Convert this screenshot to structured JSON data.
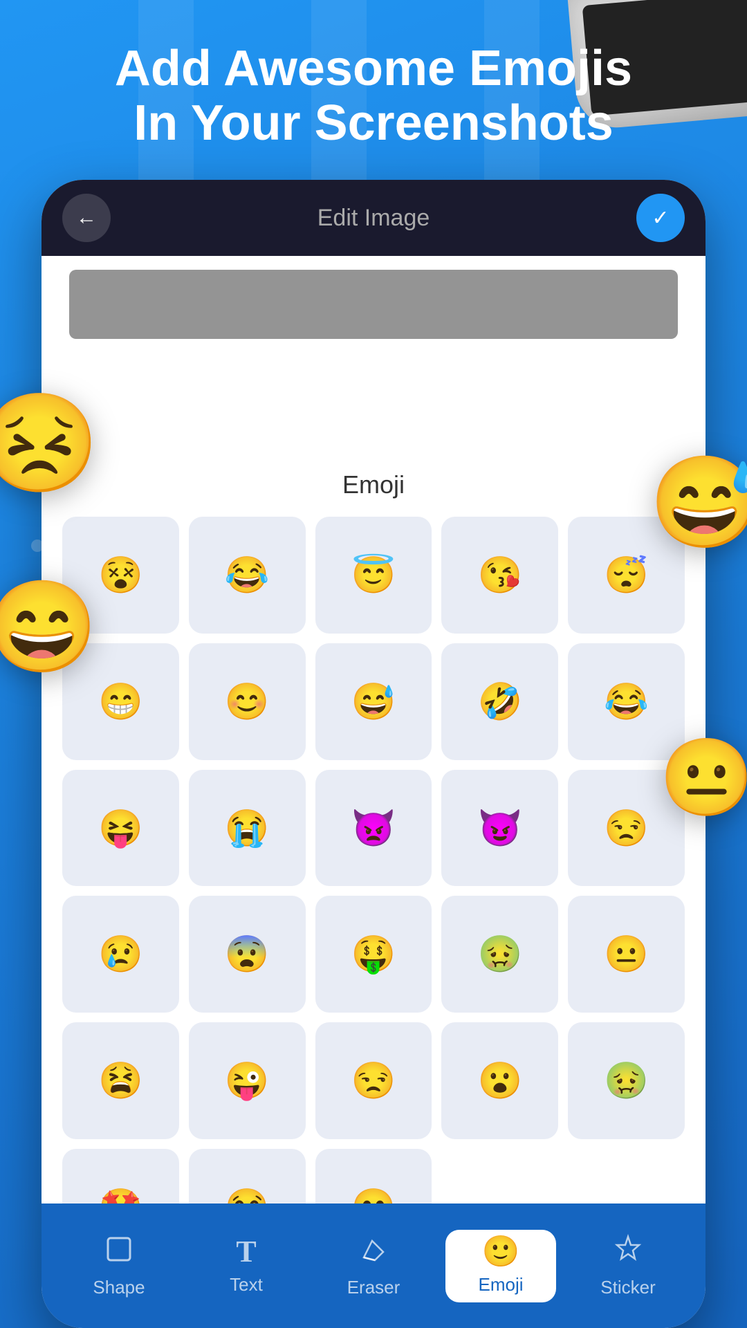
{
  "header": {
    "line1": "Add Awesome Emojis",
    "line2": "In Your Screenshots"
  },
  "topbar": {
    "title": "Edit Image",
    "back_icon": "←",
    "check_icon": "✓"
  },
  "emoji_panel": {
    "title": "Emoji"
  },
  "emojis": [
    "😵",
    "😂",
    "😇",
    "😘",
    "😴",
    "😁",
    "😊",
    "😅",
    "🤣",
    "😂",
    "😝",
    "😭",
    "👿",
    "😈",
    "😒",
    "😢",
    "😨",
    "🤑",
    "🤮",
    "😐",
    "😫",
    "😜",
    "😒",
    "😮",
    "🤢",
    "🤩",
    "😂",
    "😄"
  ],
  "floating_emojis": {
    "left1": "😣",
    "left2": "😄",
    "right1": "😅",
    "right2": "😐"
  },
  "bottom_nav": {
    "items": [
      {
        "id": "shape",
        "label": "Shape",
        "icon": "⬜",
        "active": false
      },
      {
        "id": "text",
        "label": "Text",
        "icon": "T",
        "active": false
      },
      {
        "id": "eraser",
        "label": "Eraser",
        "icon": "⌫",
        "active": false
      },
      {
        "id": "emoji",
        "label": "Emoji",
        "icon": "🙂",
        "active": true
      },
      {
        "id": "sticker",
        "label": "Sticker",
        "icon": "⚙",
        "active": false
      }
    ]
  }
}
